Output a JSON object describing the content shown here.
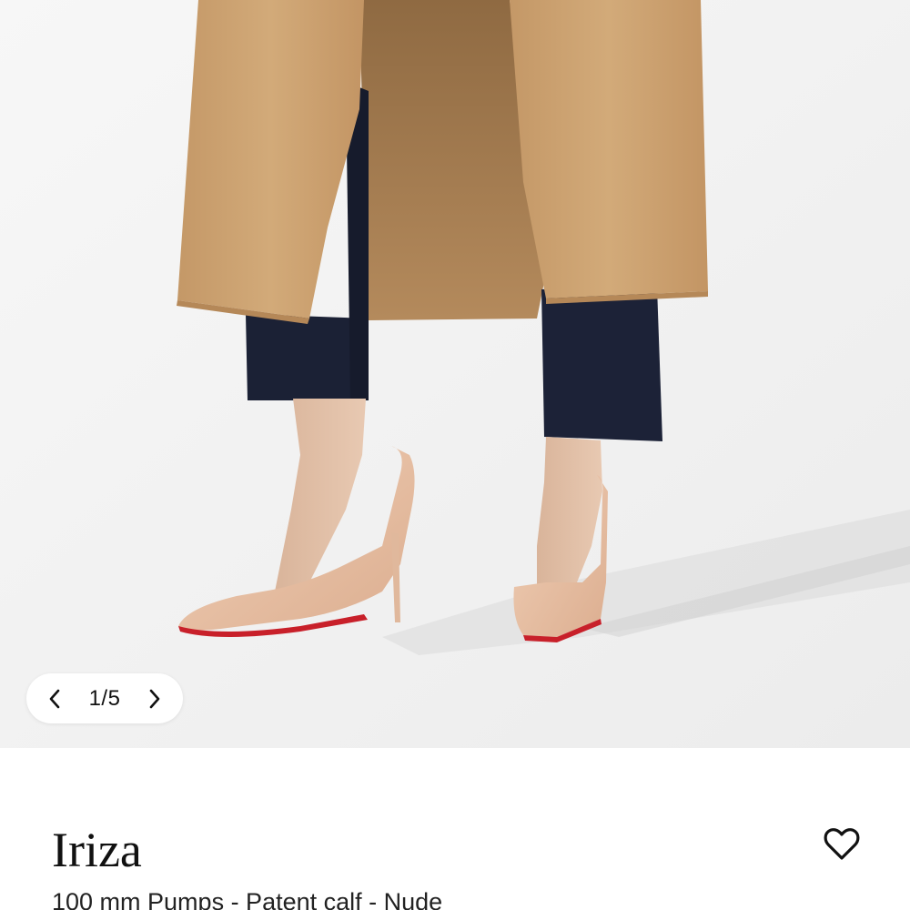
{
  "gallery": {
    "counter": "1/5",
    "prev_icon": "chevron-left-icon",
    "next_icon": "chevron-right-icon",
    "image_alt": "Model wearing camel coat, navy trousers and nude patent pumps"
  },
  "product": {
    "name": "Iriza",
    "subtitle": "100 mm Pumps - Patent calf - Nude",
    "wishlist_icon": "heart-outline-icon"
  },
  "colors": {
    "coat": "#c9a06e",
    "trousers": "#1c2236",
    "shoe": "#e8c3a8",
    "sole": "#c8202a",
    "text": "#111111"
  }
}
